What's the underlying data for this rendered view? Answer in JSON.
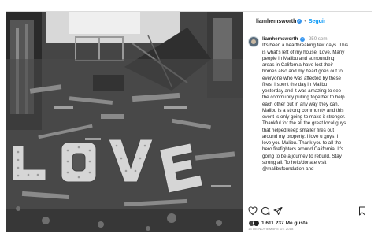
{
  "post": {
    "username": "liamhemsworth",
    "follow_label": "Seguir",
    "separator": "•",
    "more_label": "···",
    "caption_time": "250 sem",
    "caption_lines": [
      "It's been a heartbreaking few days. This",
      "is what's left of my house. Love. Many",
      "people in Malibu and surrounding",
      "areas in California have lost their",
      "homes also and my heart goes out to",
      "everyone who was affected by these",
      "fires. I spent the day in Malibu",
      "yesterday and it was amazing to see",
      "the community pulling together to help",
      "each other out in any way they can.",
      "Malibu is a strong community and this",
      "event is only going to make it stronger.",
      "Thankful for the all the great local guys",
      "that helped keep smaller fires out",
      "around my property. I love u guys. I",
      "love you Malibu. Thank you to all the",
      "hero firefighters around California. It's",
      "going to be a journey to rebuild. Stay",
      "strong all. To help/donate visit",
      "@malibufoundation and"
    ],
    "likes_count": "1.611.237",
    "likes_label": "Me gusta",
    "date": "13 DE NOVIEMBRE DE 2018"
  },
  "photo": {
    "sign_letters": [
      "L",
      "O",
      "V",
      "E"
    ]
  },
  "colors": {
    "link_blue": "#0095f6",
    "verified_blue": "#3897f0",
    "muted": "#8e8e8e",
    "text": "#262626"
  },
  "icons": [
    "heart-icon",
    "comment-icon",
    "share-icon",
    "bookmark-icon",
    "verified-badge-icon",
    "more-options-icon"
  ]
}
